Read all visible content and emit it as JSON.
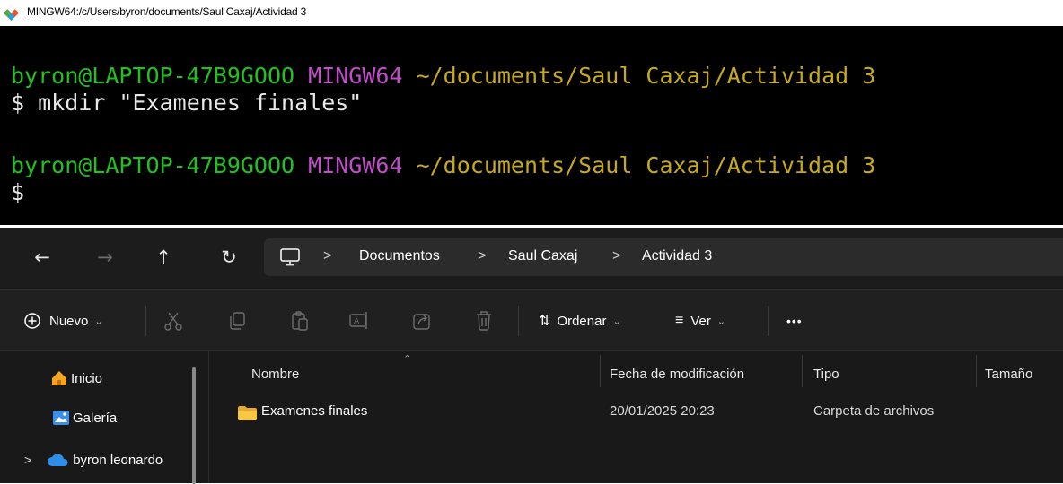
{
  "terminal": {
    "window_title": "MINGW64:/c/Users/byron/documents/Saul Caxaj/Actividad 3",
    "lines": [
      {
        "user_host": "byron@LAPTOP-47B9GOOO",
        "env": "MINGW64",
        "path": "~/documents/Saul Caxaj/Actividad 3"
      },
      {
        "prompt": "$",
        "command": "mkdir \"Examenes finales\""
      },
      {
        "user_host": "byron@LAPTOP-47B9GOOO",
        "env": "MINGW64",
        "path": "~/documents/Saul Caxaj/Actividad 3"
      },
      {
        "prompt": "$",
        "command": ""
      }
    ],
    "colors": {
      "user_host": "#23bf23",
      "env": "#c04ec9",
      "path": "#c6a91c",
      "text": "#e8e8e8"
    }
  },
  "explorer": {
    "nav": {
      "back": "←",
      "forward": "→",
      "up": "↑",
      "refresh": "↻"
    },
    "breadcrumb": {
      "separator": ">",
      "items": [
        "Documentos",
        "Saul Caxaj",
        "Actividad 3"
      ]
    },
    "toolbar": {
      "new_label": "Nuevo",
      "sort_label": "Ordenar",
      "view_label": "Ver",
      "more_label": "•••"
    },
    "sidebar": {
      "items": [
        {
          "label": "Inicio",
          "icon": "home-icon"
        },
        {
          "label": "Galería",
          "icon": "gallery-icon"
        },
        {
          "label": "byron leonardo",
          "icon": "onedrive-cloud-icon"
        }
      ],
      "expand_glyph": ">"
    },
    "columns": [
      "Nombre",
      "Fecha de modificación",
      "Tipo",
      "Tamaño"
    ],
    "files": [
      {
        "name": "Examenes finales",
        "modified": "20/01/2025 20:23",
        "type": "Carpeta de archivos",
        "size": ""
      }
    ]
  }
}
